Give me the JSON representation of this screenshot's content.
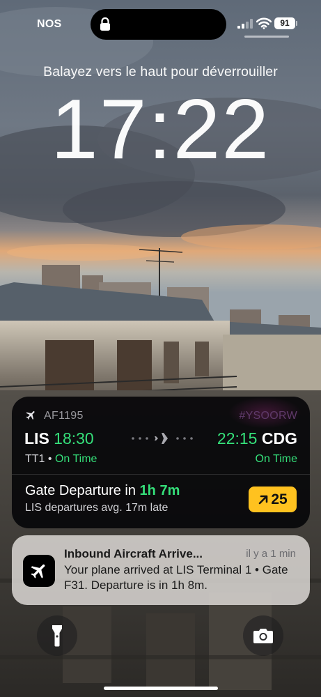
{
  "status_bar": {
    "carrier": "NOS",
    "battery": "91",
    "icons": [
      "lock-icon",
      "signal-icon",
      "wifi-icon",
      "battery-icon"
    ]
  },
  "lock_screen": {
    "unlock_hint": "Balayez vers le haut pour déverrouiller",
    "time": "17:22"
  },
  "live_activity": {
    "flight_number": "AF1195",
    "booking_ref": "#YSOORW",
    "origin": {
      "code": "LIS",
      "time": "18:30",
      "terminal": "TT1",
      "separator": "•",
      "status": "On Time"
    },
    "destination": {
      "code": "CDG",
      "time": "22:15",
      "status": "On Time"
    },
    "gate_departure_label": "Gate Departure in",
    "gate_departure_eta": "1h 7m",
    "avg_delay": "LIS departures avg. 17m late",
    "gate_badge": "25",
    "colors": {
      "on_time": "#35e07a",
      "badge": "#ffc21f"
    }
  },
  "notification": {
    "title": "Inbound Aircraft Arrive...",
    "time": "il y a 1 min",
    "body": "Your plane arrived at LIS Terminal 1 • Gate F31. Departure is in 1h 8m."
  },
  "quick_actions": {
    "left_icon": "flashlight-icon",
    "right_icon": "camera-icon"
  }
}
